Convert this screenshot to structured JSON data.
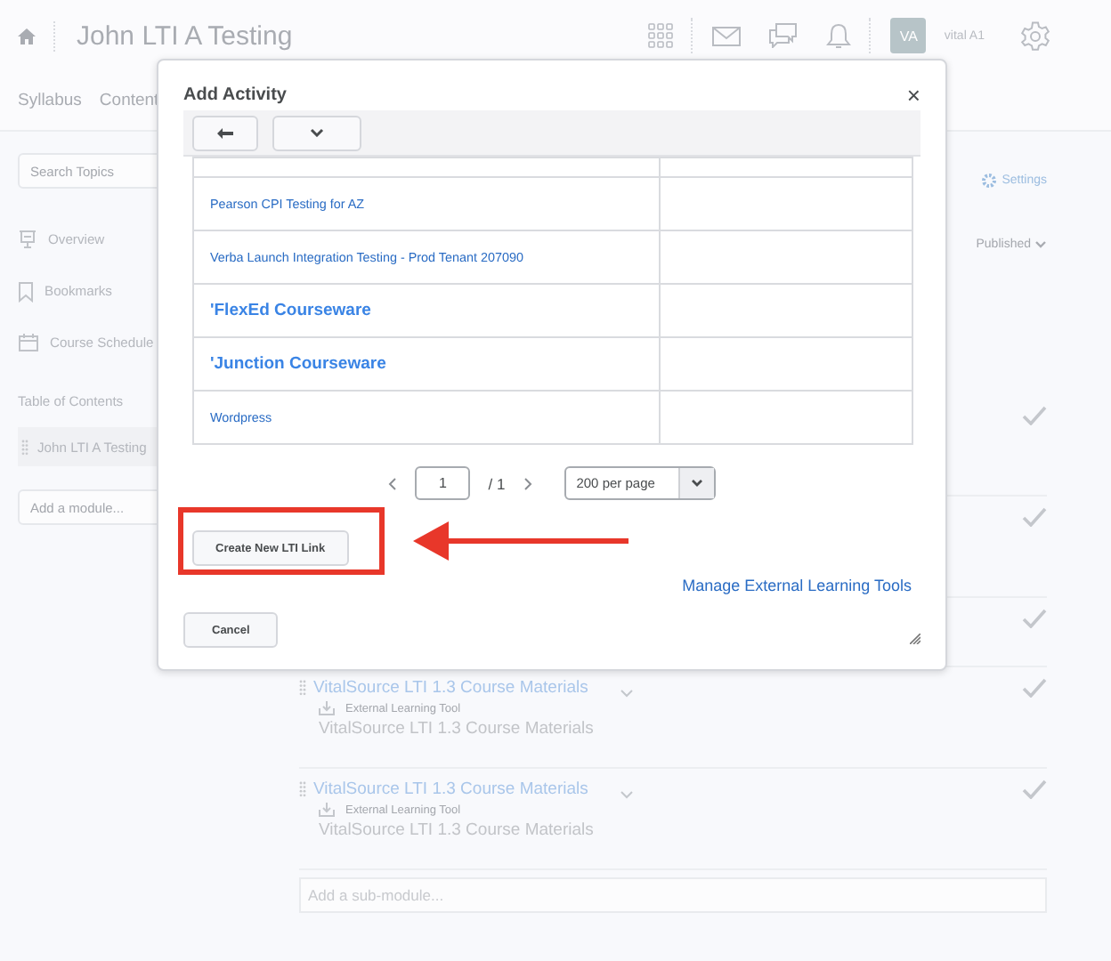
{
  "header": {
    "course_title": "John LTI A Testing",
    "avatar_initials": "VA",
    "user_name": "vital A1"
  },
  "nav": {
    "tabs": [
      {
        "label": "Syllabus"
      },
      {
        "label": "Content"
      }
    ]
  },
  "sidebar": {
    "search": {
      "placeholder": "Search Topics"
    },
    "items": [
      {
        "label": "Overview",
        "kind": "overview"
      },
      {
        "label": "Bookmarks",
        "kind": "bookmarks"
      },
      {
        "label": "Course Schedule",
        "kind": "schedule"
      }
    ],
    "toc_heading": "Table of Contents",
    "modules": [
      {
        "label": "John LTI A Testing"
      }
    ],
    "add_module": {
      "placeholder": "Add a module..."
    }
  },
  "main": {
    "settings_label": "Settings",
    "status": "Published",
    "rows": [
      {
        "checked": true
      },
      {
        "checked": true
      },
      {
        "checked": true
      },
      {
        "title": "VitalSource LTI 1.3 Course Materials",
        "type": "External Learning Tool",
        "description": "VitalSource LTI 1.3 Course Materials",
        "checked": true
      },
      {
        "title": "VitalSource LTI 1.3 Course Materials",
        "type": "External Learning Tool",
        "description": "VitalSource LTI 1.3 Course Materials",
        "checked": true
      }
    ],
    "add_submodule": {
      "placeholder": "Add a sub-module..."
    }
  },
  "modal": {
    "title": "Add Activity",
    "close_label": "×",
    "tools": [
      {
        "name": "Pearson CPI Testing for AZ",
        "kind": "link"
      },
      {
        "name": "Verba Launch Integration Testing - Prod Tenant 207090",
        "kind": "link"
      },
      {
        "name": "'FlexEd Courseware",
        "kind": "bold"
      },
      {
        "name": "'Junction Courseware",
        "kind": "bold"
      },
      {
        "name": "Wordpress",
        "kind": "link"
      }
    ],
    "pagination": {
      "page": "1",
      "total": "/ 1",
      "page_size": "200 per page"
    },
    "create_button": "Create New LTI Link",
    "manage_link": "Manage External Learning Tools",
    "cancel_button": "Cancel"
  }
}
